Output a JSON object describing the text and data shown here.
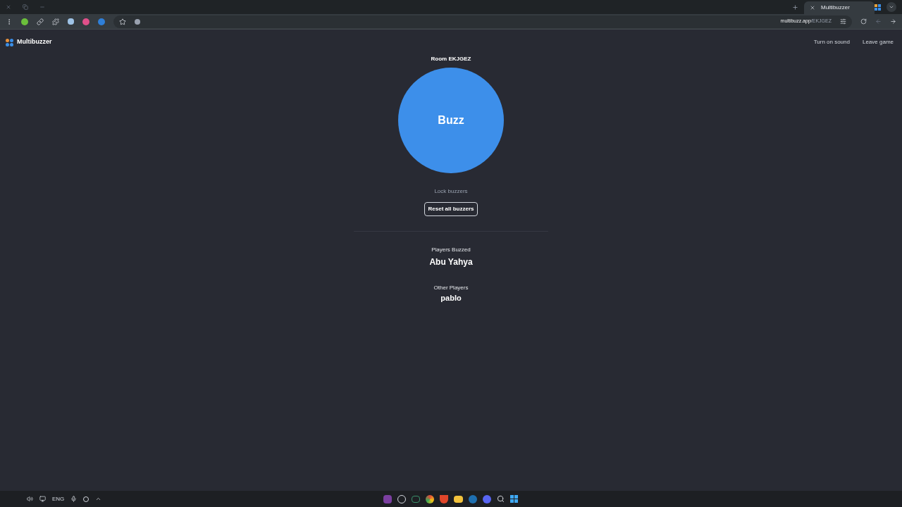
{
  "browser": {
    "tab_title": "Multibuzzer",
    "url_host": "multibuzz.app",
    "url_path": "/EKJGEZ"
  },
  "header": {
    "brand": "Multibuzzer",
    "links": [
      "Turn on sound",
      "Leave game"
    ]
  },
  "room": "Room EKJGEZ",
  "buzz_button": "Buzz",
  "lock_link": "Lock buzzers",
  "reset_button": "Reset all buzzers",
  "sections": [
    {
      "heading": "Players Buzzed",
      "kind": "buzzed",
      "players": [
        "Abu Yahya"
      ]
    },
    {
      "heading": "Other Players",
      "kind": "other",
      "players": [
        "pablo"
      ]
    }
  ],
  "taskbar": {
    "language": "ENG"
  }
}
